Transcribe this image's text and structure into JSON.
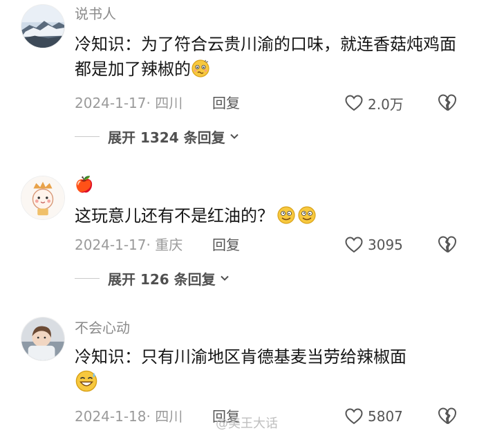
{
  "comments": [
    {
      "username": "说书人",
      "text": "冷知识：为了符合云贵川渝的口味，就连香菇炖鸡面都是加了辣椒的",
      "text_emoji": "confused-face-emoji",
      "date_location": "2024-1-17· 四川",
      "reply_label": "回复",
      "like_count": "2.0万",
      "expand_label": "展开 1324 条回复"
    },
    {
      "username": "🍎",
      "text": "这玩意儿还有不是红油的？",
      "text_emoji": "dizzy-smile-emoji",
      "date_location": "2024-1-17· 重庆",
      "reply_label": "回复",
      "like_count": "3095",
      "expand_label": "展开 126 条回复"
    },
    {
      "username": "不会心动",
      "text_line1": "冷知识：只有川渝地区肯德基麦当劳给辣椒面",
      "text_emoji": "grin-sweat-emoji",
      "date_location": "2024-1-18· 四川",
      "reply_label": "回复",
      "like_count": "5807"
    }
  ],
  "watermark": "@美王大话",
  "icons": {
    "like": "heart-outline-icon",
    "dislike": "broken-heart-icon",
    "expand": "chevron-down-icon"
  },
  "colors": {
    "text": "#161616",
    "meta": "#9a9a9a",
    "username": "#8a8a8a",
    "emoji_yellow": "#f7c83e"
  }
}
